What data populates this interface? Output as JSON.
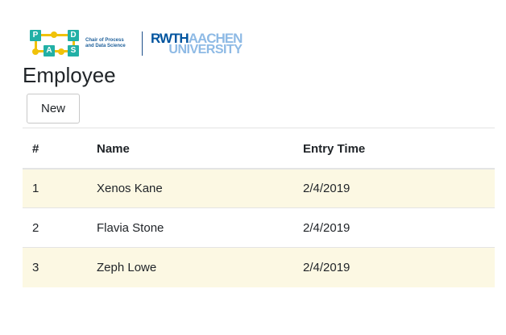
{
  "logo": {
    "pads_letters": [
      "P",
      "D",
      "A",
      "S"
    ],
    "pads_caption_line1": "Chair of Process",
    "pads_caption_line2": "and Data Science",
    "rwth_part": "RWTH",
    "aachen_part": "AACHEN",
    "university_part": "UNIVERSITY",
    "colors": {
      "teal": "#22b0a6",
      "yellow": "#f0c20a",
      "rwth_blue": "#00549f",
      "light_blue": "#8ebae5"
    }
  },
  "page": {
    "title": "Employee",
    "new_button_label": "New"
  },
  "table": {
    "headers": [
      "#",
      "Name",
      "Entry Time"
    ],
    "rows": [
      {
        "num": "1",
        "name": "Xenos Kane",
        "entry_time": "2/4/2019"
      },
      {
        "num": "2",
        "name": "Flavia Stone",
        "entry_time": "2/4/2019"
      },
      {
        "num": "3",
        "name": "Zeph Lowe",
        "entry_time": "2/4/2019"
      }
    ],
    "striped_row_color": "#fcf8e3"
  }
}
